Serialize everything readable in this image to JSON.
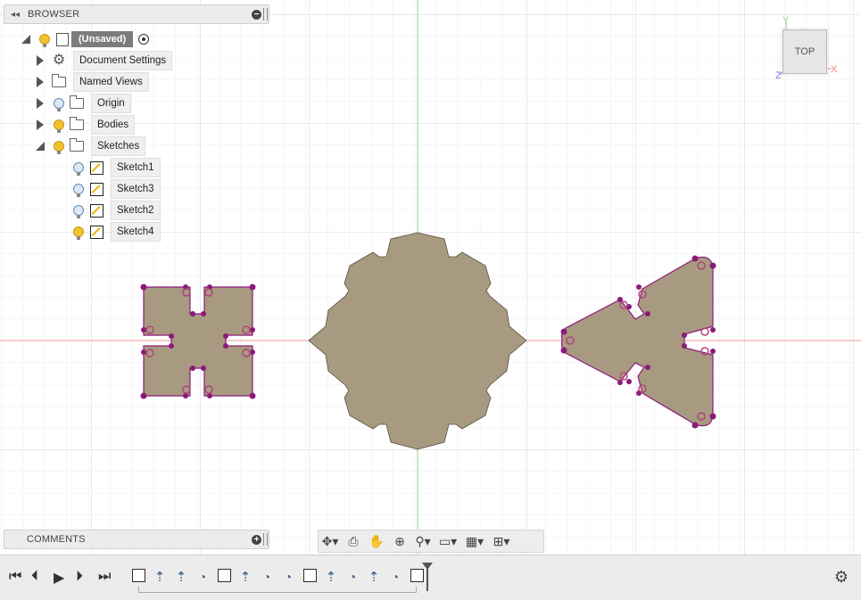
{
  "browser": {
    "title": "BROWSER",
    "root_label": "(Unsaved)",
    "items": [
      {
        "label": "Document Settings",
        "icon": "gear-icon"
      },
      {
        "label": "Named Views",
        "icon": "folder-icon"
      },
      {
        "label": "Origin",
        "icon": "folder-icon"
      },
      {
        "label": "Bodies",
        "icon": "folder-icon"
      },
      {
        "label": "Sketches",
        "icon": "folder-icon"
      }
    ],
    "sketches": [
      {
        "label": "Sketch1"
      },
      {
        "label": "Sketch3"
      },
      {
        "label": "Sketch2"
      },
      {
        "label": "Sketch4"
      }
    ]
  },
  "comments": {
    "title": "COMMENTS"
  },
  "viewcube": {
    "face": "TOP",
    "axis_y": "Y",
    "axis_x": "X",
    "axis_z": "Z"
  },
  "colors": {
    "body_fill": "#a89a80",
    "sketch_line": "#8b1a7a",
    "axis_red": "#f19a9a",
    "axis_green": "#8fd08f",
    "grid": "#e4e4e4",
    "bulb_on": "#f2c12e"
  },
  "navbar": {
    "icons": [
      "orbit-icon",
      "look-at-icon",
      "pan-icon",
      "zoom-icon",
      "zoom-window-icon",
      "display-settings-icon",
      "grid-settings-icon",
      "viewports-icon"
    ]
  },
  "timeline": {
    "features": [
      "sketch",
      "extrude",
      "extrude",
      "fillet",
      "sketch",
      "extrude",
      "fillet",
      "fillet",
      "sketch",
      "extrude",
      "fillet",
      "extrude",
      "fillet",
      "sketch"
    ]
  }
}
